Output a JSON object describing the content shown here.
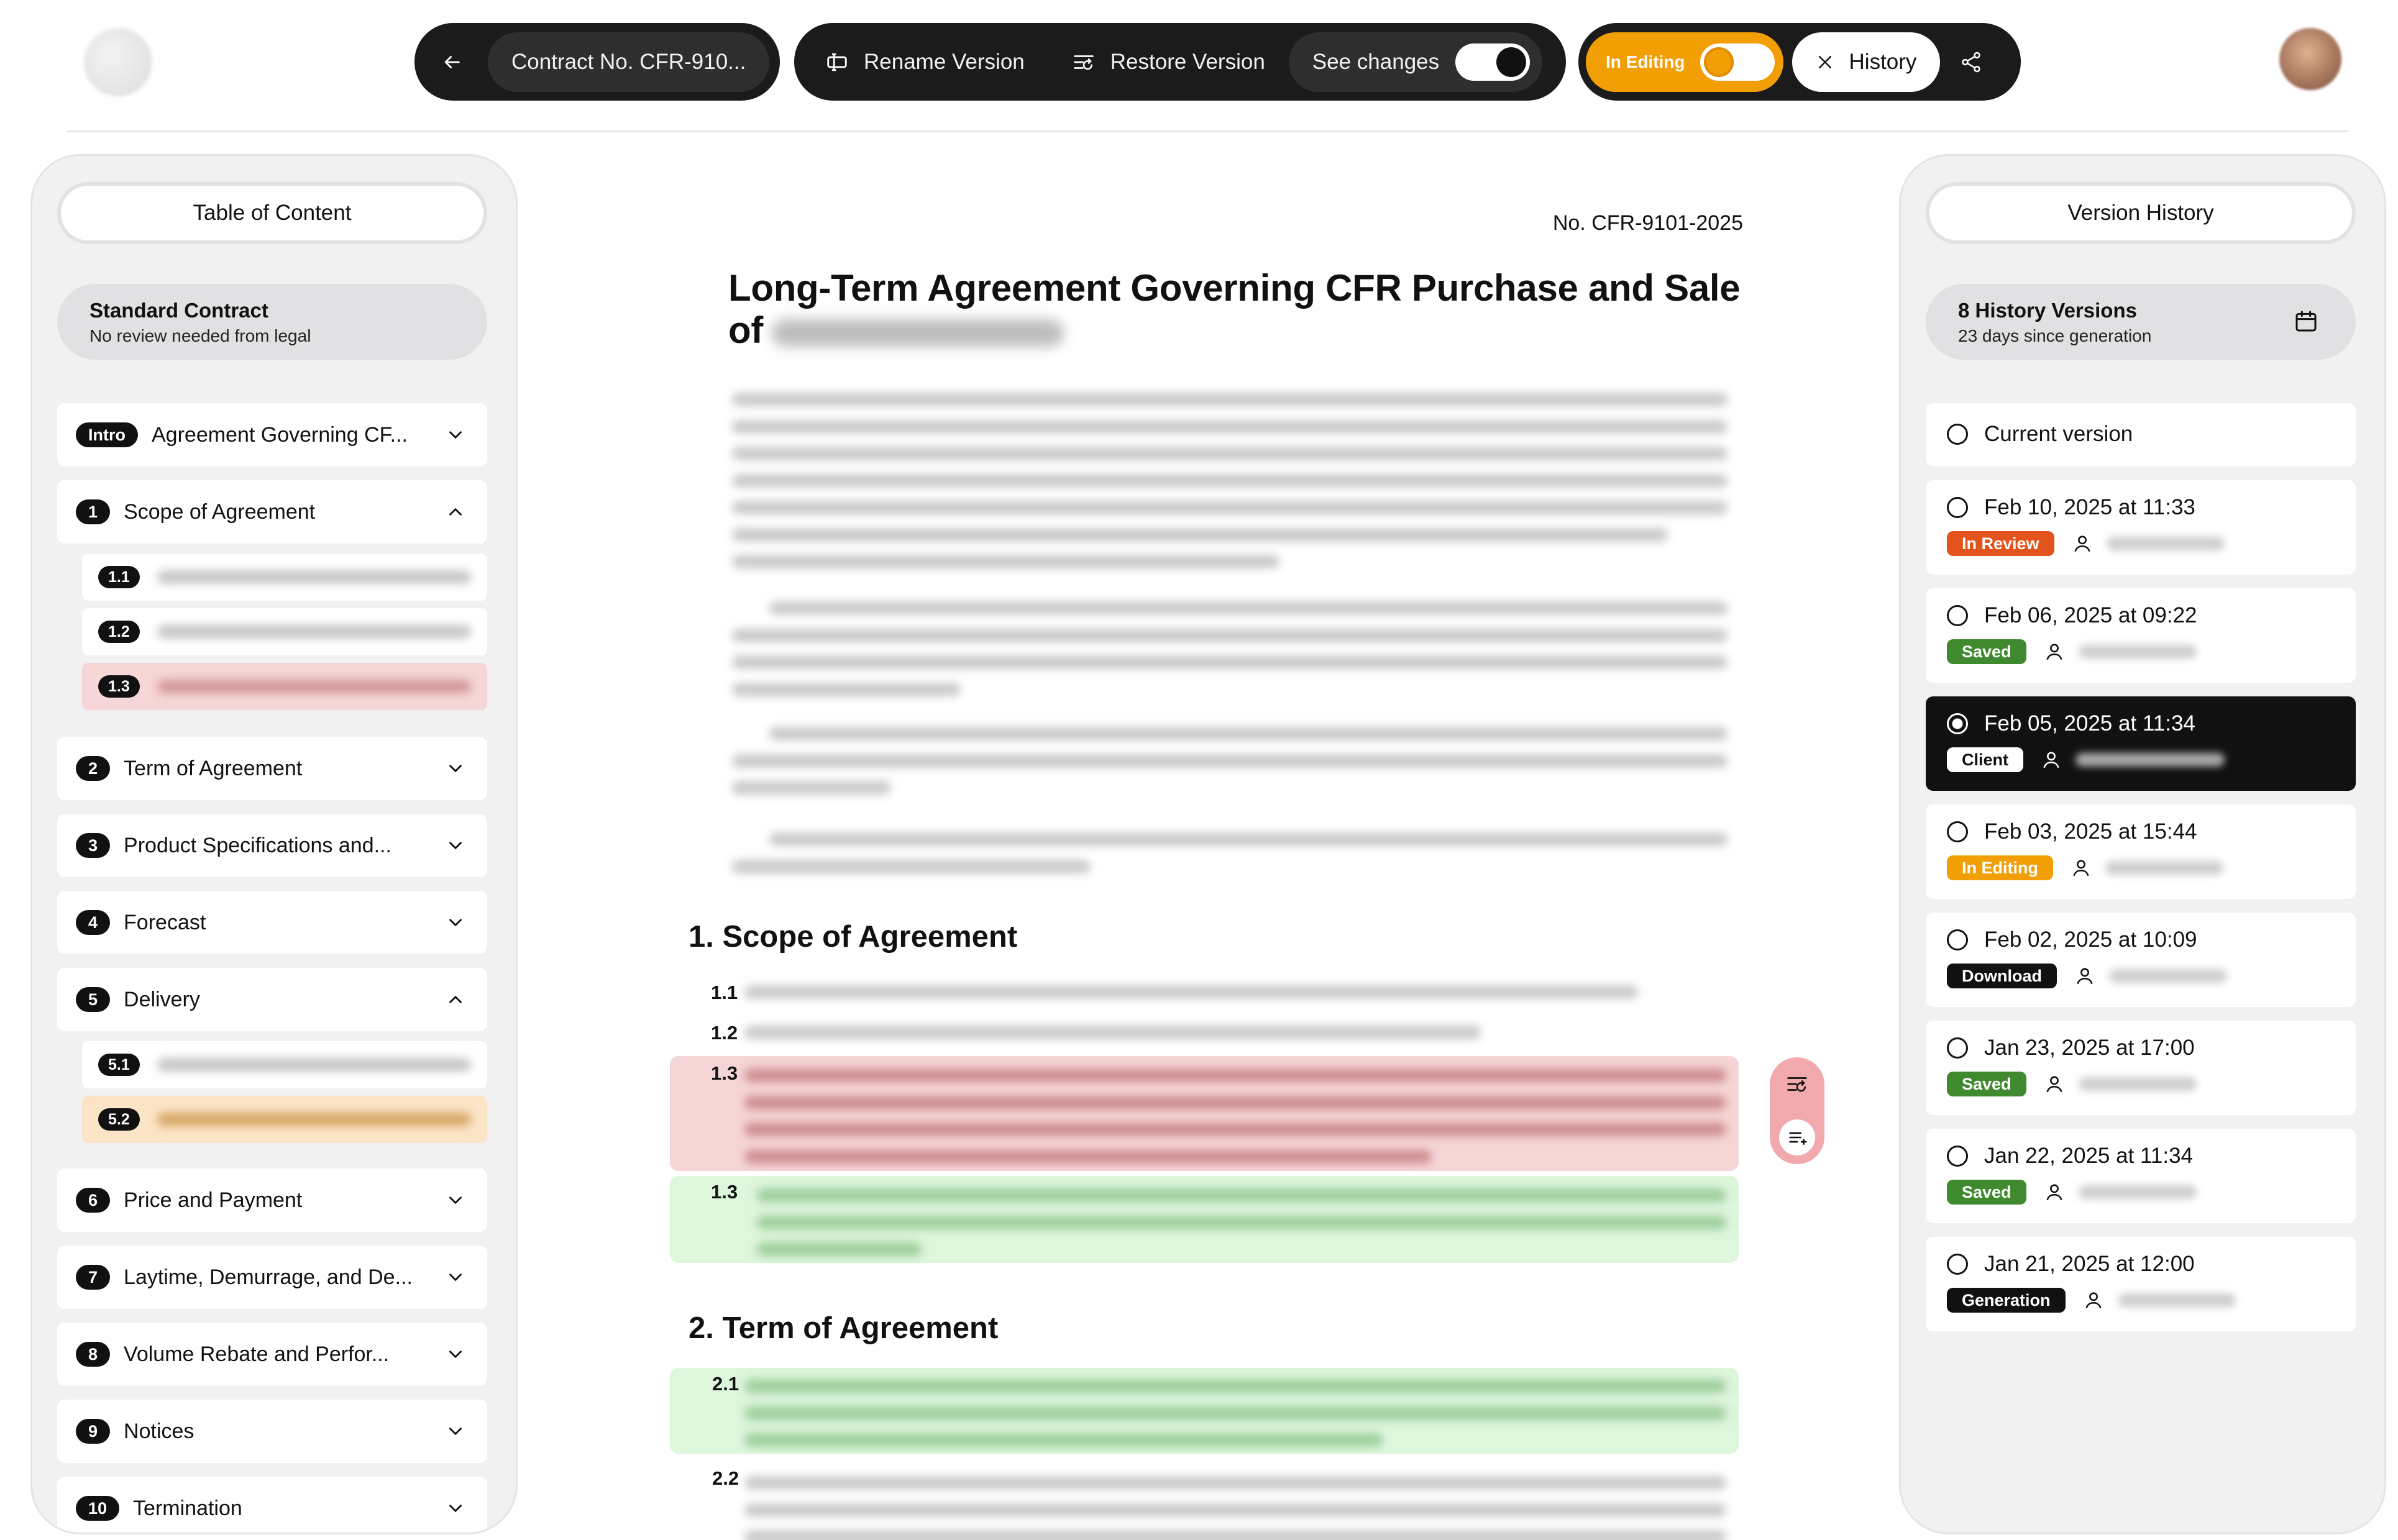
{
  "topbar": {
    "contract_label": "Contract No. CFR-910...",
    "rename_label": "Rename Version",
    "restore_label": "Restore Version",
    "see_changes_label": "See changes",
    "see_changes_on": true,
    "in_editing_label": "In Editing",
    "history_label": "History"
  },
  "toc": {
    "header": "Table of Content",
    "card_title": "Standard Contract",
    "card_subtitle": "No review needed from legal",
    "items": [
      {
        "badge": "Intro",
        "label": "Agreement Governing CF...",
        "expanded": false
      },
      {
        "badge": "1",
        "label": "Scope of Agreement",
        "expanded": true
      },
      {
        "badge": "1.1",
        "sub": true
      },
      {
        "badge": "1.2",
        "sub": true
      },
      {
        "badge": "1.3",
        "sub": true,
        "highlight": "red"
      },
      {
        "badge": "2",
        "label": "Term of Agreement",
        "expanded": false
      },
      {
        "badge": "3",
        "label": "Product Specifications and...",
        "expanded": false
      },
      {
        "badge": "4",
        "label": "Forecast",
        "expanded": false
      },
      {
        "badge": "5",
        "label": "Delivery",
        "expanded": true
      },
      {
        "badge": "5.1",
        "sub": true
      },
      {
        "badge": "5.2",
        "sub": true,
        "highlight": "orange"
      },
      {
        "badge": "6",
        "label": "Price and Payment",
        "expanded": false
      },
      {
        "badge": "7",
        "label": "Laytime, Demurrage, and De...",
        "expanded": false
      },
      {
        "badge": "8",
        "label": "Volume Rebate and Perfor...",
        "expanded": false
      },
      {
        "badge": "9",
        "label": "Notices",
        "expanded": false
      },
      {
        "badge": "10",
        "label": "Termination",
        "expanded": false
      }
    ]
  },
  "document": {
    "number": "No. CFR-9101-2025",
    "title": "Long-Term Agreement Governing CFR Purchase and Sale of",
    "section1_title": "1. Scope of Agreement",
    "section2_title": "2. Term of Agreement",
    "clause_numbers": [
      "1.1",
      "1.2",
      "1.3",
      "1.3",
      "2.1",
      "2.2"
    ]
  },
  "history": {
    "header": "Version History",
    "card_title": "8 History Versions",
    "card_subtitle": "23 days since generation",
    "current_label": "Current version",
    "versions": [
      {
        "date": "Feb 10, 2025 at 11:33",
        "status": "In Review",
        "color": "#e2541c",
        "selected": false
      },
      {
        "date": "Feb 06, 2025 at 09:22",
        "status": "Saved",
        "color": "#3f8a2e",
        "selected": false
      },
      {
        "date": "Feb 05, 2025 at 11:34",
        "status": "Client",
        "color": "#ffffff",
        "selected": true
      },
      {
        "date": "Feb 03, 2025 at 15:44",
        "status": "In Editing",
        "color": "#f29f05",
        "selected": false
      },
      {
        "date": "Feb 02, 2025 at 10:09",
        "status": "Download",
        "color": "#111111",
        "selected": false
      },
      {
        "date": "Jan 23, 2025 at 17:00",
        "status": "Saved",
        "color": "#3f8a2e",
        "selected": false
      },
      {
        "date": "Jan 22, 2025 at 11:34",
        "status": "Saved",
        "color": "#3f8a2e",
        "selected": false
      },
      {
        "date": "Jan 21, 2025 at 12:00",
        "status": "Generation",
        "color": "#111111",
        "selected": false
      }
    ]
  },
  "colors": {
    "accent_orange": "#f29f05",
    "removed_bg": "#f6d5d6",
    "added_bg": "#ddf6dc",
    "dark": "#1b1b1b"
  }
}
